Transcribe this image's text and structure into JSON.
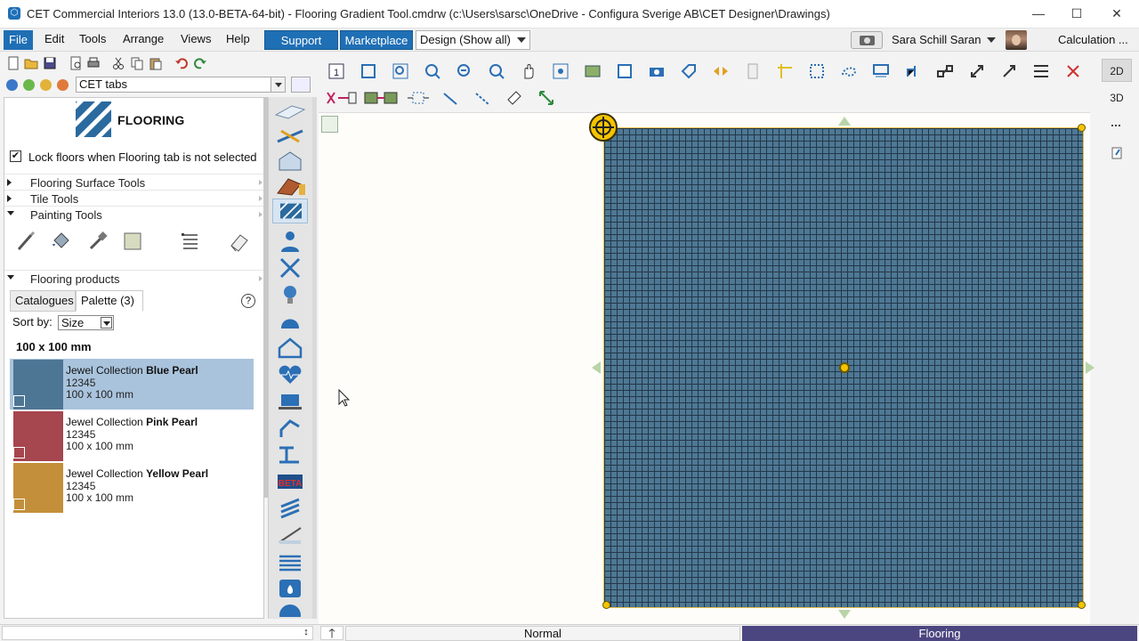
{
  "app": {
    "title": "CET Commercial Interiors 13.0 (13.0-BETA-64-bit) - Flooring Gradient Tool.cmdrw (c:\\Users\\sarsc\\OneDrive - Configura Sverige AB\\CET Designer\\Drawings)",
    "icon": "cet-app-icon",
    "window_controls": {
      "minimize": "—",
      "maximize": "☐",
      "close": "✕"
    }
  },
  "menu": {
    "items": [
      "File",
      "Edit",
      "Tools",
      "Arrange",
      "Views",
      "Help"
    ],
    "support": "Support",
    "marketplace": "Marketplace",
    "design_select": "Design (Show all)",
    "user_name": "Sara Schill Saran",
    "calculation": "Calculation ..."
  },
  "left_toolbar": {
    "tabs_select": "CET tabs"
  },
  "panel": {
    "title": "FLOORING",
    "lock_label": "Lock floors when Flooring tab is not selected",
    "lock_checked": true,
    "sections": [
      {
        "label": "Flooring Surface Tools",
        "expanded": false
      },
      {
        "label": "Tile Tools",
        "expanded": false
      },
      {
        "label": "Painting Tools",
        "expanded": true
      }
    ],
    "products_section": "Flooring products",
    "tabs": {
      "catalogues": "Catalogues",
      "palette": "Palette (3)"
    },
    "help": "?",
    "sort_by_label": "Sort by:",
    "sort_value": "Size",
    "group_label": "100 x 100 mm",
    "products": [
      {
        "collection": "Jewel Collection",
        "name": "Blue Pearl",
        "code": "12345",
        "dims": "100 x 100 mm",
        "color": "#4d7594",
        "selected": true
      },
      {
        "collection": "Jewel Collection",
        "name": "Pink Pearl",
        "code": "12345",
        "dims": "100 x 100 mm",
        "color": "#a6464e",
        "selected": false
      },
      {
        "collection": "Jewel Collection",
        "name": "Yellow Pearl",
        "code": "12345",
        "dims": "100 x 100 mm",
        "color": "#c38f3a",
        "selected": false
      }
    ]
  },
  "view_buttons": {
    "twod": "2D",
    "threed": "3D"
  },
  "statusbar": {
    "mode": "Normal",
    "active_tab": "Flooring"
  },
  "colors": {
    "accent": "#1f6fb5",
    "floor_tile": "#4e7894",
    "grout": "#233749",
    "handle": "#f5c400",
    "status_tab": "#4b4680"
  }
}
